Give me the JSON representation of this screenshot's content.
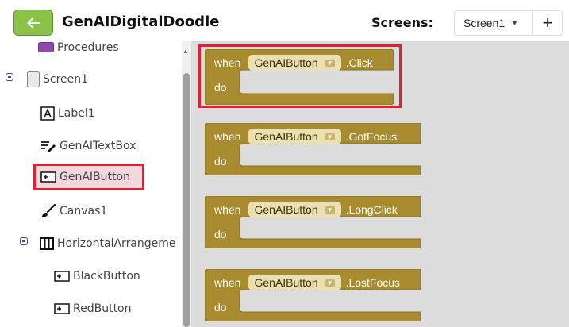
{
  "header": {
    "project_title": "GenAIDigitalDoodle",
    "screens_label": "Screens:",
    "screen_selected": "Screen1",
    "add_screen_label": "+",
    "accent_color": "#8bc34a"
  },
  "tree": {
    "items": [
      {
        "label": "Procedures",
        "icon": "procedures-icon"
      },
      {
        "label": "Screen1",
        "icon": "screen-icon"
      },
      {
        "label": "Label1",
        "icon": "label-icon"
      },
      {
        "label": "GenAITextBox",
        "icon": "textbox-icon"
      },
      {
        "label": "GenAIButton",
        "icon": "button-icon"
      },
      {
        "label": "Canvas1",
        "icon": "canvas-icon"
      },
      {
        "label": "HorizontalArrangeme",
        "icon": "horizontal-arrangement-icon"
      },
      {
        "label": "BlackButton",
        "icon": "button-icon"
      },
      {
        "label": "RedButton",
        "icon": "button-icon"
      }
    ]
  },
  "blocks": [
    {
      "when": "when",
      "component": "GenAIButton",
      "event": ".Click",
      "do": "do"
    },
    {
      "when": "when",
      "component": "GenAIButton",
      "event": ".GotFocus",
      "do": "do"
    },
    {
      "when": "when",
      "component": "GenAIButton",
      "event": ".LongClick",
      "do": "do"
    },
    {
      "when": "when",
      "component": "GenAIButton",
      "event": ".LostFocus",
      "do": "do"
    }
  ],
  "colors": {
    "block_fill": "#a88b2e",
    "highlight": "#e0202c",
    "workspace": "#dcdcdc"
  }
}
